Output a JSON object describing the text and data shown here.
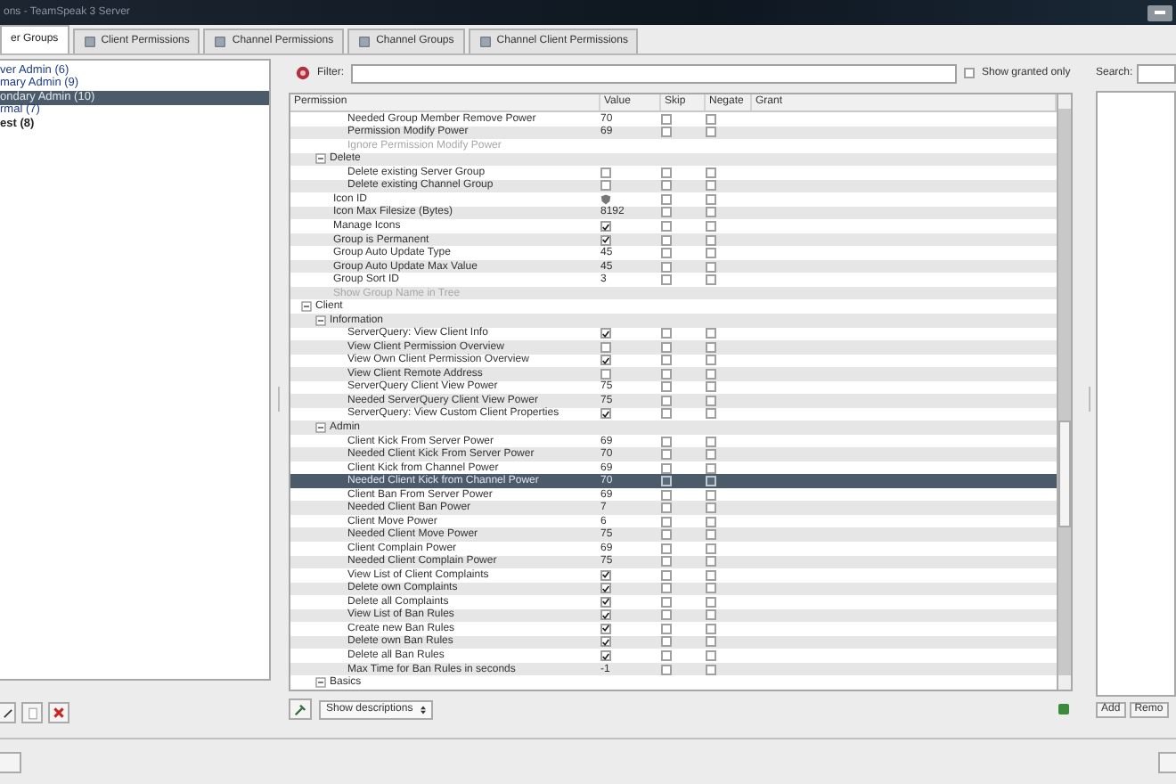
{
  "window": {
    "title": "ons - TeamSpeak 3 Server"
  },
  "tabs": [
    {
      "label": "er Groups",
      "selected": true
    },
    {
      "label": "Client Permissions",
      "selected": false
    },
    {
      "label": "Channel Permissions",
      "selected": false
    },
    {
      "label": "Channel Groups",
      "selected": false
    },
    {
      "label": "Channel Client Permissions",
      "selected": false
    }
  ],
  "groups": [
    {
      "label": "ver Admin (6)",
      "selected": false,
      "bold": false
    },
    {
      "label": "mary Admin (9)",
      "selected": false,
      "bold": false
    },
    {
      "label": "ondary Admin (10)",
      "selected": true,
      "bold": false
    },
    {
      "label": "rmal (7)",
      "selected": false,
      "bold": false
    },
    {
      "label": "est (8)",
      "selected": false,
      "bold": true
    }
  ],
  "filter": {
    "label": "Filter:",
    "show_granted_only": {
      "label": "Show granted only",
      "checked": false
    }
  },
  "columns": [
    "Permission",
    "Value",
    "Skip",
    "Negate",
    "Grant"
  ],
  "permissions": [
    {
      "children": [
        {
          "children": [
            {
              "kind": "text",
              "label": "Needed Group Member Remove Power",
              "value": "70",
              "skip": false,
              "negate": false,
              "selected": false
            },
            {
              "kind": "text",
              "label": "Permission Modify Power",
              "value": "69",
              "skip": false,
              "negate": false,
              "selected": false
            },
            {
              "kind": "inactive",
              "label": "Ignore Permission Modify Power",
              "selected": false
            }
          ]
        },
        {
          "kind": "group",
          "label": "Delete",
          "expanded": true,
          "selected": false,
          "children": [
            {
              "kind": "check",
              "label": "Delete existing Server Group",
              "checked": false,
              "skip": false,
              "negate": false,
              "selected": false
            },
            {
              "kind": "check",
              "label": "Delete existing Channel Group",
              "checked": false,
              "skip": false,
              "negate": false,
              "selected": false
            }
          ]
        },
        {
          "kind": "icon",
          "label": "Icon ID",
          "skip": false,
          "negate": false,
          "selected": false
        },
        {
          "kind": "text",
          "label": "Icon Max Filesize (Bytes)",
          "value": "8192",
          "skip": false,
          "negate": false,
          "selected": false
        },
        {
          "kind": "check",
          "label": "Manage Icons",
          "checked": true,
          "skip": false,
          "negate": false,
          "selected": false
        },
        {
          "kind": "check",
          "label": "Group is Permanent",
          "checked": true,
          "skip": false,
          "negate": false,
          "selected": false
        },
        {
          "kind": "text",
          "label": "Group Auto Update Type",
          "value": "45",
          "skip": false,
          "negate": false,
          "selected": false
        },
        {
          "kind": "text",
          "label": "Group Auto Update Max Value",
          "value": "45",
          "skip": false,
          "negate": false,
          "selected": false
        },
        {
          "kind": "text",
          "label": "Group Sort ID",
          "value": "3",
          "skip": false,
          "negate": false,
          "selected": false
        },
        {
          "kind": "inactive",
          "label": "Show Group Name in Tree",
          "selected": false
        }
      ]
    },
    {
      "kind": "group",
      "label": "Client",
      "expanded": true,
      "selected": false,
      "children": [
        {
          "kind": "group",
          "label": "Information",
          "expanded": true,
          "selected": false,
          "children": [
            {
              "kind": "check",
              "label": "ServerQuery: View Client Info",
              "checked": true,
              "skip": false,
              "negate": false,
              "selected": false
            },
            {
              "kind": "check",
              "label": "View Client Permission Overview",
              "checked": false,
              "skip": false,
              "negate": false,
              "selected": false
            },
            {
              "kind": "check",
              "label": "View Own Client Permission Overview",
              "checked": true,
              "skip": false,
              "negate": false,
              "selected": false
            },
            {
              "kind": "check",
              "label": "View Client Remote Address",
              "checked": false,
              "skip": false,
              "negate": false,
              "selected": false
            },
            {
              "kind": "text",
              "label": "ServerQuery Client View Power",
              "value": "75",
              "skip": false,
              "negate": false,
              "selected": false
            },
            {
              "kind": "text",
              "label": "Needed ServerQuery Client View Power",
              "value": "75",
              "skip": false,
              "negate": false,
              "selected": false
            },
            {
              "kind": "check",
              "label": "ServerQuery: View Custom Client Properties",
              "checked": true,
              "skip": false,
              "negate": false,
              "selected": false
            }
          ]
        },
        {
          "kind": "group",
          "label": "Admin",
          "expanded": true,
          "selected": false,
          "children": [
            {
              "kind": "text",
              "label": "Client Kick From Server Power",
              "value": "69",
              "skip": false,
              "negate": false,
              "selected": false
            },
            {
              "kind": "text",
              "label": "Needed Client Kick From Server Power",
              "value": "70",
              "skip": false,
              "negate": false,
              "selected": false
            },
            {
              "kind": "text",
              "label": "Client Kick from Channel Power",
              "value": "69",
              "skip": false,
              "negate": false,
              "selected": false
            },
            {
              "kind": "text",
              "label": "Needed Client Kick from Channel Power",
              "value": "70",
              "skip": false,
              "negate": false,
              "selected": true
            },
            {
              "kind": "text",
              "label": "Client Ban From Server Power",
              "value": "69",
              "skip": false,
              "negate": false,
              "selected": false
            },
            {
              "kind": "text",
              "label": "Needed Client Ban Power",
              "value": "7",
              "skip": false,
              "negate": false,
              "selected": false
            },
            {
              "kind": "text",
              "label": "Client Move Power",
              "value": "6",
              "skip": false,
              "negate": false,
              "selected": false
            },
            {
              "kind": "text",
              "label": "Needed Client Move Power",
              "value": "75",
              "skip": false,
              "negate": false,
              "selected": false
            },
            {
              "kind": "text",
              "label": "Client Complain Power",
              "value": "69",
              "skip": false,
              "negate": false,
              "selected": false
            },
            {
              "kind": "text",
              "label": "Needed Client Complain Power",
              "value": "75",
              "skip": false,
              "negate": false,
              "selected": false
            },
            {
              "kind": "check",
              "label": "View List of Client Complaints",
              "checked": true,
              "skip": false,
              "negate": false,
              "selected": false
            },
            {
              "kind": "check",
              "label": "Delete own Complaints",
              "checked": true,
              "skip": false,
              "negate": false,
              "selected": false
            },
            {
              "kind": "check",
              "label": "Delete all Complaints",
              "checked": true,
              "skip": false,
              "negate": false,
              "selected": false
            },
            {
              "kind": "check",
              "label": "View List of Ban Rules",
              "checked": true,
              "skip": false,
              "negate": false,
              "selected": false
            },
            {
              "kind": "check",
              "label": "Create new Ban Rules",
              "checked": true,
              "skip": false,
              "negate": false,
              "selected": false
            },
            {
              "kind": "check",
              "label": "Delete own Ban Rules",
              "checked": true,
              "skip": false,
              "negate": false,
              "selected": false
            },
            {
              "kind": "check",
              "label": "Delete all Ban Rules",
              "checked": true,
              "skip": false,
              "negate": false,
              "selected": false
            },
            {
              "kind": "text",
              "label": "Max Time for Ban Rules in seconds",
              "value": "-1",
              "skip": false,
              "negate": false,
              "selected": false
            }
          ]
        },
        {
          "kind": "group",
          "label": "Basics",
          "expanded": true,
          "selected": false
        }
      ]
    }
  ],
  "description_select": {
    "value": "Show descriptions"
  },
  "search": {
    "label": "Search:"
  },
  "right_buttons": [
    "Add",
    "Remo"
  ]
}
